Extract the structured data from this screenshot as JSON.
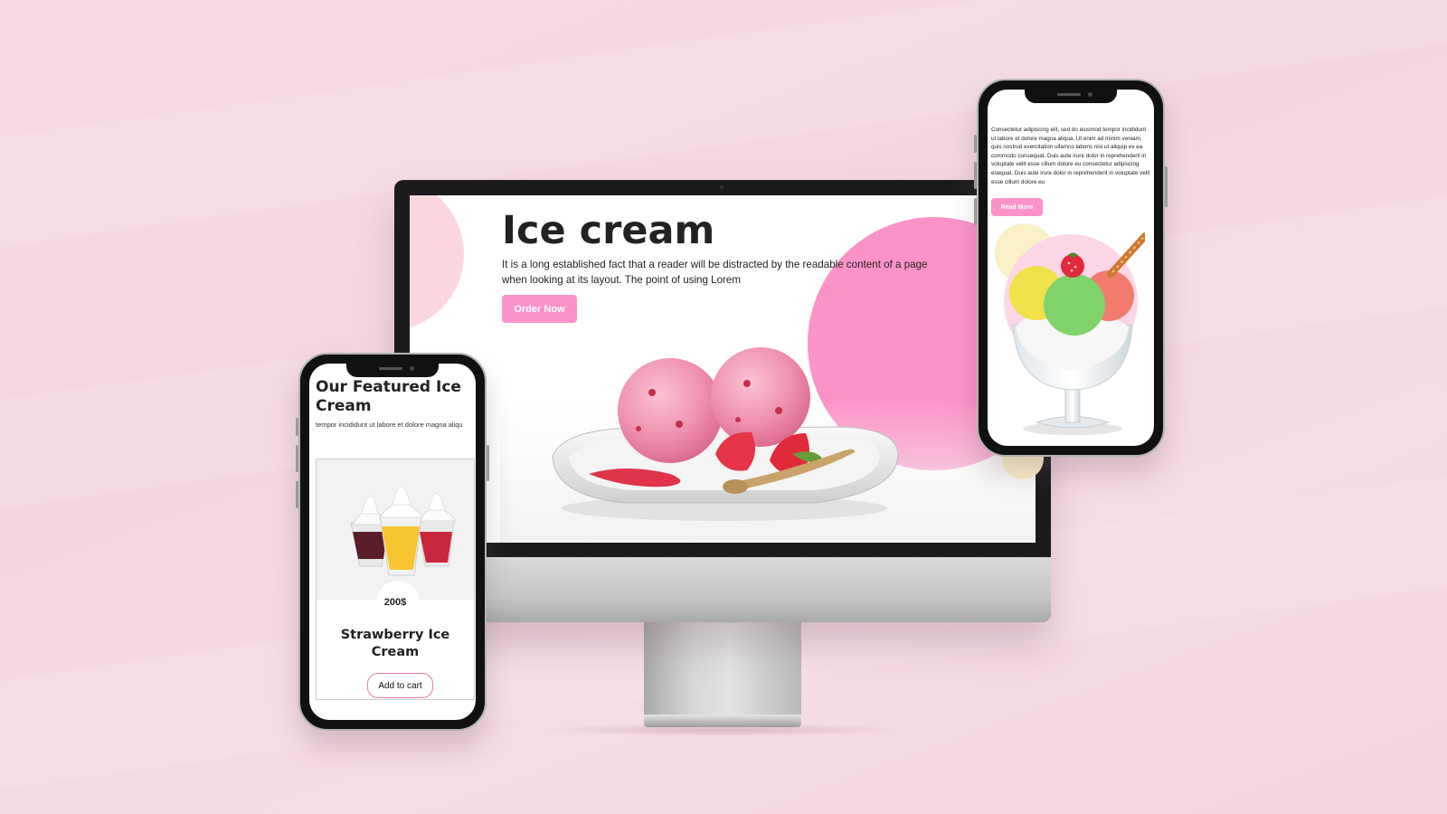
{
  "desktop": {
    "title": "Ice cream",
    "description": "It is a long established fact that a reader will be distracted by the readable content of a page when looking at its layout. The point of using Lorem",
    "order_button": "Order Now",
    "hero_image": "strawberry-ice-cream-plate"
  },
  "mobile_left": {
    "heading": "Our Featured Ice Cream",
    "subheading": "tempor incididunt ut labore et dolore magna aliqu",
    "product": {
      "image": "soft-serve-cups",
      "price": "200$",
      "name": "Strawberry Ice Cream",
      "add_button": "Add to cart"
    }
  },
  "mobile_right": {
    "text": "Consectetur adipiscing elit, sed do eiusmod tempor incididunt ut labore et dolore magna aliqua. Ut enim ad minim veniam, quis nostrud exercitation ullamco laboris nisi ut aliquip ex ea commodo consequat. Duis aute irure dolor in reprehenderit in voluptate velit esse cillum dolore eu consectetur adipiscing esequat. Duis aute irure dolor in reprehenderit in voluptate velit esse cillum dolore eu",
    "read_more_button": "Read More",
    "hero_image": "ice-cream-sundae-glass"
  },
  "colors": {
    "background": "#f4d9e3",
    "accent_pink": "#fc93c8",
    "light_pink": "#fcd6de",
    "light_yellow": "#faf0c6",
    "frame_dark": "#1b1b1d"
  }
}
